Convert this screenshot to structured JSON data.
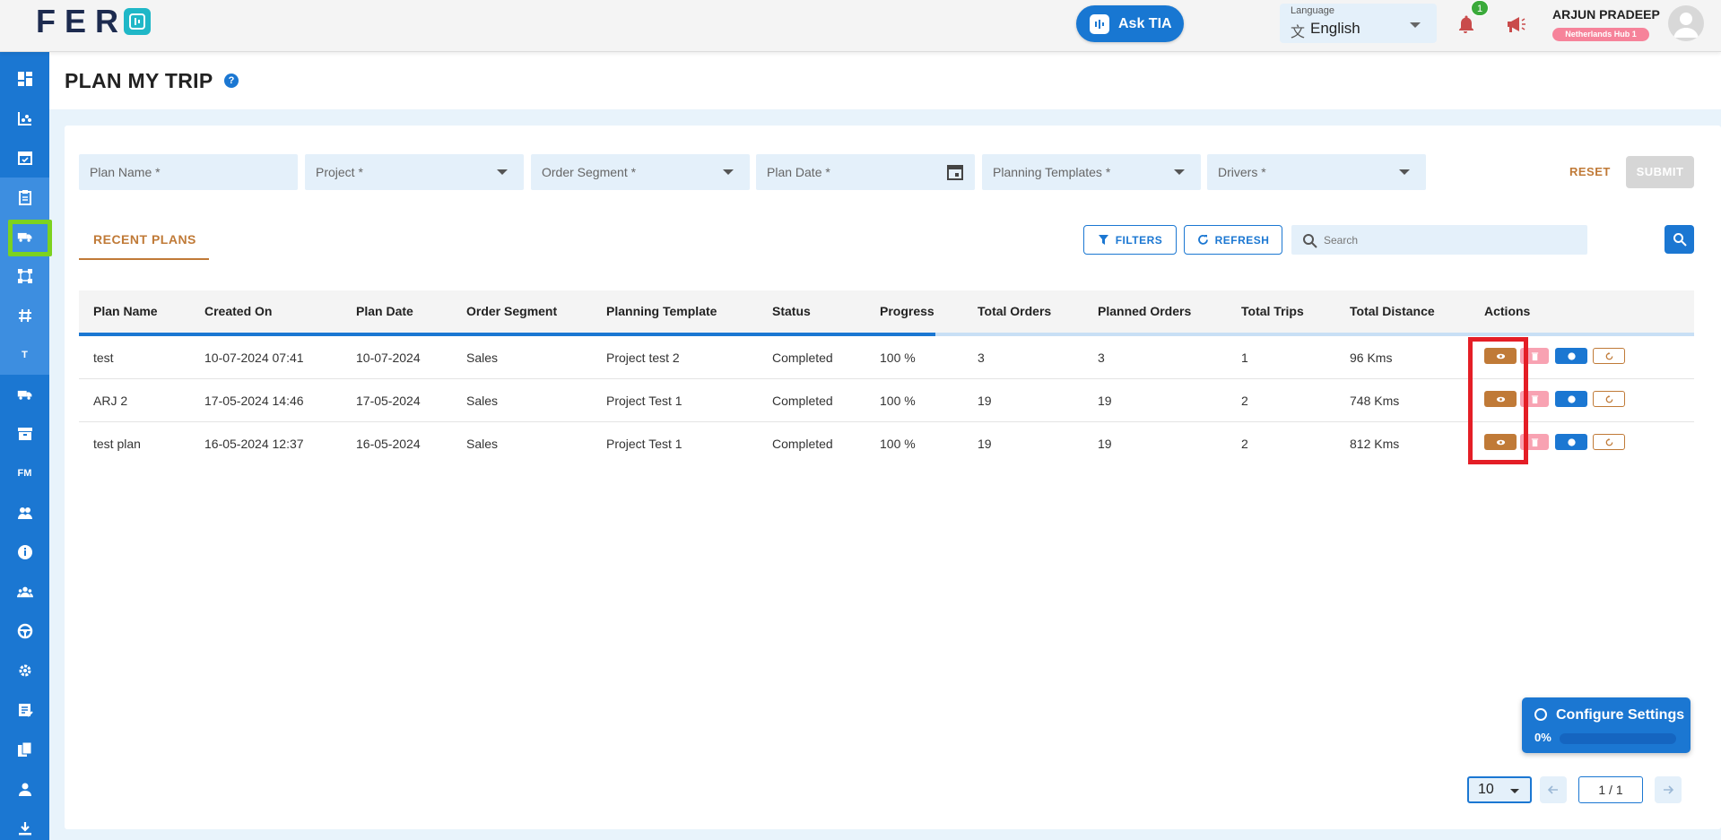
{
  "app": {
    "logo_text": "FER",
    "ask_tia_label": "Ask TIA",
    "language": {
      "label": "Language",
      "value": "English"
    },
    "notifications_count": "1",
    "user": {
      "name": "ARJUN PRADEEP",
      "hub": "Netherlands Hub 1"
    }
  },
  "sidebar": {
    "items": [
      {
        "icon": "dashboard-icon"
      },
      {
        "icon": "analytics-icon"
      },
      {
        "icon": "calendar-icon"
      },
      {
        "icon": "clipboard-icon"
      },
      {
        "icon": "truck-plan-icon"
      },
      {
        "icon": "route-network-icon"
      },
      {
        "icon": "hash-icon"
      },
      {
        "icon": "text-icon",
        "text": "T"
      },
      {
        "icon": "delivery-truck-icon"
      },
      {
        "icon": "archive-icon"
      },
      {
        "icon": "fm-icon",
        "text": "FM"
      },
      {
        "icon": "team-icon"
      },
      {
        "icon": "info-icon"
      },
      {
        "icon": "users-icon"
      },
      {
        "icon": "steering-wheel-icon"
      },
      {
        "icon": "settings-icon"
      },
      {
        "icon": "edit-note-icon"
      },
      {
        "icon": "documents-icon"
      },
      {
        "icon": "person-icon"
      },
      {
        "icon": "download-icon"
      }
    ]
  },
  "page": {
    "title": "PLAN MY TRIP",
    "help": "?"
  },
  "form": {
    "plan_name": "Plan Name *",
    "project": "Project *",
    "order_segment": "Order Segment *",
    "plan_date": "Plan Date *",
    "planning_templates": "Planning Templates *",
    "drivers": "Drivers *",
    "reset_label": "RESET",
    "submit_label": "SUBMIT"
  },
  "plans": {
    "tab_label": "RECENT PLANS",
    "filters_label": "FILTERS",
    "refresh_label": "REFRESH",
    "search_placeholder": "Search",
    "columns": [
      "Plan Name",
      "Created On",
      "Plan Date",
      "Order Segment",
      "Planning Template",
      "Status",
      "Progress",
      "Total Orders",
      "Planned Orders",
      "Total Trips",
      "Total Distance",
      "Actions"
    ],
    "load_progress": 0.53,
    "rows": [
      [
        "test",
        "10-07-2024 07:41",
        "10-07-2024",
        "Sales",
        "Project test 2",
        "Completed",
        "100 %",
        "3",
        "3",
        "1",
        "96 Kms"
      ],
      [
        "ARJ 2",
        "17-05-2024 14:46",
        "17-05-2024",
        "Sales",
        "Project Test 1",
        "Completed",
        "100 %",
        "19",
        "19",
        "2",
        "748 Kms"
      ],
      [
        "test plan",
        "16-05-2024 12:37",
        "16-05-2024",
        "Sales",
        "Project Test 1",
        "Completed",
        "100 %",
        "19",
        "19",
        "2",
        "812 Kms"
      ]
    ]
  },
  "config_widget": {
    "title": "Configure Settings",
    "percent": "0%",
    "progress": 0
  },
  "pagination": {
    "page_size": "10",
    "indicator": "1 / 1"
  },
  "colors": {
    "primary": "#1b77d2",
    "accent": "#c07a37",
    "highlight": "#e41e26",
    "sidebar_highlight": "#7cd21f"
  }
}
